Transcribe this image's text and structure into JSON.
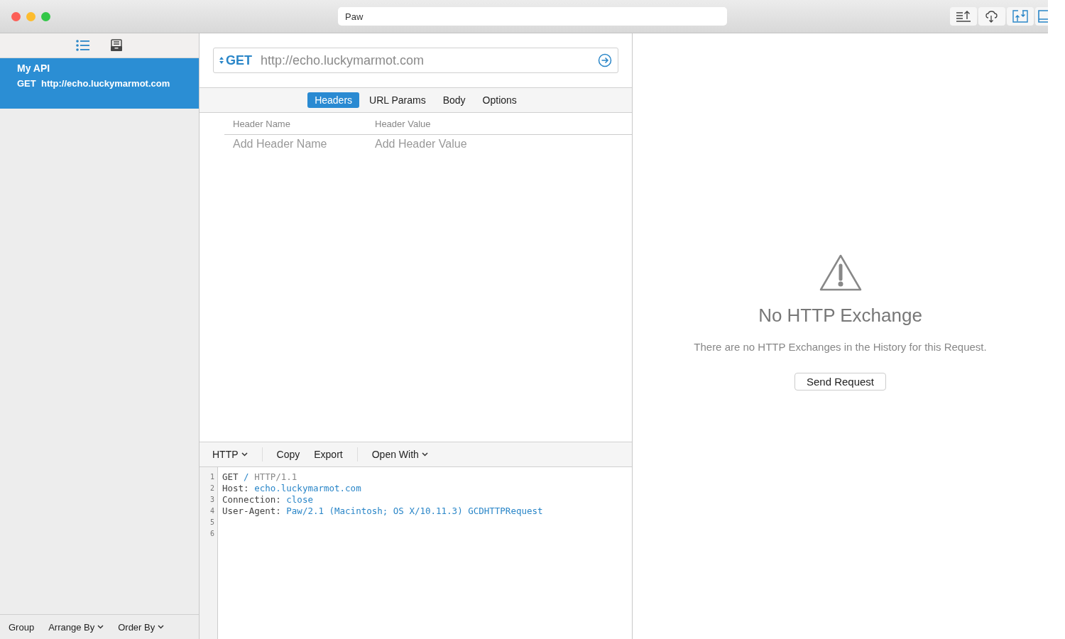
{
  "window": {
    "title": "Paw"
  },
  "sidebar": {
    "views": [
      {
        "kind": "list",
        "selected": true
      },
      {
        "kind": "archive",
        "selected": false
      }
    ],
    "items": [
      {
        "name": "My API",
        "method": "GET",
        "url": "http://echo.luckymarmot.com",
        "selected": true
      }
    ],
    "footer": [
      {
        "label": "Group",
        "dropdown": false
      },
      {
        "label": "Arrange By",
        "dropdown": true
      },
      {
        "label": "Order By",
        "dropdown": true
      }
    ]
  },
  "request": {
    "method": "GET",
    "url": "http://echo.luckymarmot.com",
    "tabs": [
      {
        "label": "Headers",
        "selected": true
      },
      {
        "label": "URL Params",
        "selected": false
      },
      {
        "label": "Body",
        "selected": false
      },
      {
        "label": "Options",
        "selected": false
      }
    ],
    "headers_table": {
      "columns": [
        "Header Name",
        "Header Value"
      ],
      "placeholders": [
        "Add Header Name",
        "Add Header Value"
      ]
    }
  },
  "code_toolbar": [
    {
      "label": "HTTP",
      "dropdown": true,
      "separator_before": false
    },
    {
      "label": "Copy",
      "dropdown": false,
      "separator_before": true
    },
    {
      "label": "Export",
      "dropdown": false,
      "separator_before": false
    },
    {
      "label": "Open With",
      "dropdown": true,
      "separator_before": true
    }
  ],
  "code": [
    {
      "number": "1",
      "parts": [
        {
          "text": "GET ",
          "kind": "plain"
        },
        {
          "text": "/",
          "kind": "value"
        },
        {
          "text": " HTTP/1.1",
          "kind": "muted"
        }
      ]
    },
    {
      "number": "2",
      "parts": [
        {
          "text": "Host: ",
          "kind": "plain"
        },
        {
          "text": "echo.luckymarmot.com",
          "kind": "value"
        }
      ]
    },
    {
      "number": "3",
      "parts": [
        {
          "text": "Connection: ",
          "kind": "plain"
        },
        {
          "text": "close",
          "kind": "value"
        }
      ]
    },
    {
      "number": "4",
      "parts": [
        {
          "text": "User-Agent: ",
          "kind": "plain"
        },
        {
          "text": "Paw/2.1 (Macintosh; OS X/10.11.3) GCDHTTPRequest",
          "kind": "value"
        }
      ]
    },
    {
      "number": "5"
    },
    {
      "number": "6"
    }
  ],
  "response": {
    "title": "No HTTP Exchange",
    "message": "There are no HTTP Exchanges in the History for this Request.",
    "button": "Send Request"
  }
}
